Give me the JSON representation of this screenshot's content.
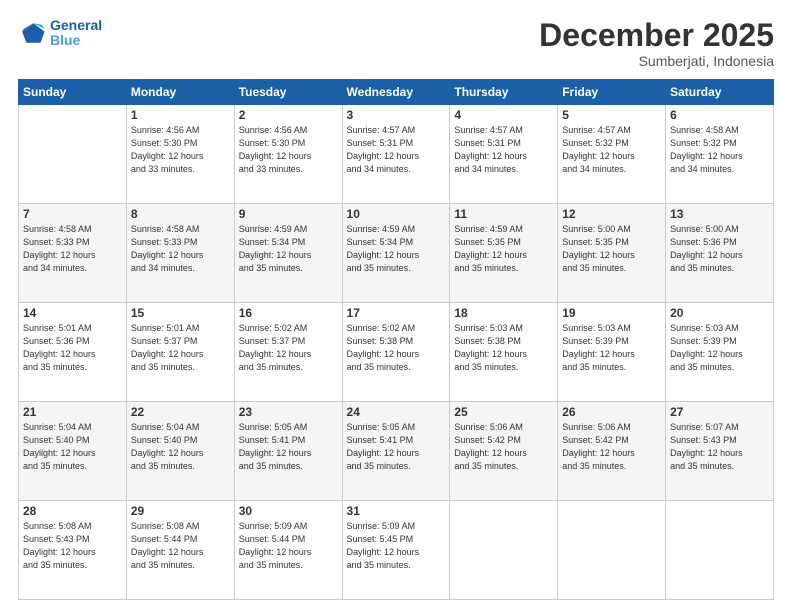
{
  "header": {
    "logo_line1": "General",
    "logo_line2": "Blue",
    "month": "December 2025",
    "location": "Sumberjati, Indonesia"
  },
  "weekdays": [
    "Sunday",
    "Monday",
    "Tuesday",
    "Wednesday",
    "Thursday",
    "Friday",
    "Saturday"
  ],
  "weeks": [
    [
      {
        "day": "",
        "info": ""
      },
      {
        "day": "1",
        "info": "Sunrise: 4:56 AM\nSunset: 5:30 PM\nDaylight: 12 hours\nand 33 minutes."
      },
      {
        "day": "2",
        "info": "Sunrise: 4:56 AM\nSunset: 5:30 PM\nDaylight: 12 hours\nand 33 minutes."
      },
      {
        "day": "3",
        "info": "Sunrise: 4:57 AM\nSunset: 5:31 PM\nDaylight: 12 hours\nand 34 minutes."
      },
      {
        "day": "4",
        "info": "Sunrise: 4:57 AM\nSunset: 5:31 PM\nDaylight: 12 hours\nand 34 minutes."
      },
      {
        "day": "5",
        "info": "Sunrise: 4:57 AM\nSunset: 5:32 PM\nDaylight: 12 hours\nand 34 minutes."
      },
      {
        "day": "6",
        "info": "Sunrise: 4:58 AM\nSunset: 5:32 PM\nDaylight: 12 hours\nand 34 minutes."
      }
    ],
    [
      {
        "day": "7",
        "info": "Sunrise: 4:58 AM\nSunset: 5:33 PM\nDaylight: 12 hours\nand 34 minutes."
      },
      {
        "day": "8",
        "info": "Sunrise: 4:58 AM\nSunset: 5:33 PM\nDaylight: 12 hours\nand 34 minutes."
      },
      {
        "day": "9",
        "info": "Sunrise: 4:59 AM\nSunset: 5:34 PM\nDaylight: 12 hours\nand 35 minutes."
      },
      {
        "day": "10",
        "info": "Sunrise: 4:59 AM\nSunset: 5:34 PM\nDaylight: 12 hours\nand 35 minutes."
      },
      {
        "day": "11",
        "info": "Sunrise: 4:59 AM\nSunset: 5:35 PM\nDaylight: 12 hours\nand 35 minutes."
      },
      {
        "day": "12",
        "info": "Sunrise: 5:00 AM\nSunset: 5:35 PM\nDaylight: 12 hours\nand 35 minutes."
      },
      {
        "day": "13",
        "info": "Sunrise: 5:00 AM\nSunset: 5:36 PM\nDaylight: 12 hours\nand 35 minutes."
      }
    ],
    [
      {
        "day": "14",
        "info": "Sunrise: 5:01 AM\nSunset: 5:36 PM\nDaylight: 12 hours\nand 35 minutes."
      },
      {
        "day": "15",
        "info": "Sunrise: 5:01 AM\nSunset: 5:37 PM\nDaylight: 12 hours\nand 35 minutes."
      },
      {
        "day": "16",
        "info": "Sunrise: 5:02 AM\nSunset: 5:37 PM\nDaylight: 12 hours\nand 35 minutes."
      },
      {
        "day": "17",
        "info": "Sunrise: 5:02 AM\nSunset: 5:38 PM\nDaylight: 12 hours\nand 35 minutes."
      },
      {
        "day": "18",
        "info": "Sunrise: 5:03 AM\nSunset: 5:38 PM\nDaylight: 12 hours\nand 35 minutes."
      },
      {
        "day": "19",
        "info": "Sunrise: 5:03 AM\nSunset: 5:39 PM\nDaylight: 12 hours\nand 35 minutes."
      },
      {
        "day": "20",
        "info": "Sunrise: 5:03 AM\nSunset: 5:39 PM\nDaylight: 12 hours\nand 35 minutes."
      }
    ],
    [
      {
        "day": "21",
        "info": "Sunrise: 5:04 AM\nSunset: 5:40 PM\nDaylight: 12 hours\nand 35 minutes."
      },
      {
        "day": "22",
        "info": "Sunrise: 5:04 AM\nSunset: 5:40 PM\nDaylight: 12 hours\nand 35 minutes."
      },
      {
        "day": "23",
        "info": "Sunrise: 5:05 AM\nSunset: 5:41 PM\nDaylight: 12 hours\nand 35 minutes."
      },
      {
        "day": "24",
        "info": "Sunrise: 5:05 AM\nSunset: 5:41 PM\nDaylight: 12 hours\nand 35 minutes."
      },
      {
        "day": "25",
        "info": "Sunrise: 5:06 AM\nSunset: 5:42 PM\nDaylight: 12 hours\nand 35 minutes."
      },
      {
        "day": "26",
        "info": "Sunrise: 5:06 AM\nSunset: 5:42 PM\nDaylight: 12 hours\nand 35 minutes."
      },
      {
        "day": "27",
        "info": "Sunrise: 5:07 AM\nSunset: 5:43 PM\nDaylight: 12 hours\nand 35 minutes."
      }
    ],
    [
      {
        "day": "28",
        "info": "Sunrise: 5:08 AM\nSunset: 5:43 PM\nDaylight: 12 hours\nand 35 minutes."
      },
      {
        "day": "29",
        "info": "Sunrise: 5:08 AM\nSunset: 5:44 PM\nDaylight: 12 hours\nand 35 minutes."
      },
      {
        "day": "30",
        "info": "Sunrise: 5:09 AM\nSunset: 5:44 PM\nDaylight: 12 hours\nand 35 minutes."
      },
      {
        "day": "31",
        "info": "Sunrise: 5:09 AM\nSunset: 5:45 PM\nDaylight: 12 hours\nand 35 minutes."
      },
      {
        "day": "",
        "info": ""
      },
      {
        "day": "",
        "info": ""
      },
      {
        "day": "",
        "info": ""
      }
    ]
  ]
}
